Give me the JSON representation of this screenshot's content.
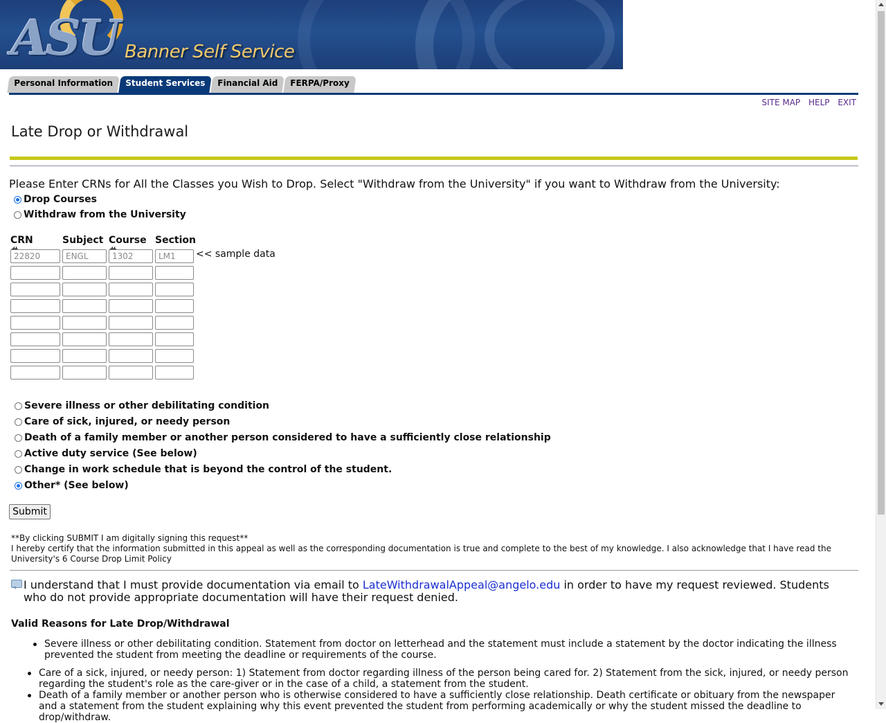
{
  "banner": {
    "logo_text": "ASU",
    "title": "Banner Self Service"
  },
  "tabs": [
    {
      "label": "Personal Information",
      "active": false
    },
    {
      "label": "Student Services",
      "active": true
    },
    {
      "label": "Financial Aid",
      "active": false
    },
    {
      "label": "FERPA/Proxy",
      "active": false
    }
  ],
  "toplinks": {
    "site_map": "SITE MAP",
    "help": "HELP",
    "exit": "EXIT"
  },
  "page": {
    "title": "Late Drop or Withdrawal"
  },
  "instructions": "Please Enter CRNs for All the Classes you Wish to Drop. Select \"Withdraw from the University\" if you want to Withdraw from the University:",
  "drop_options": [
    {
      "label": "Drop Courses",
      "checked": true
    },
    {
      "label": "Withdraw from the University",
      "checked": false
    }
  ],
  "table": {
    "headers": {
      "crn": "CRN #",
      "subject": "Subject",
      "course": "Course #",
      "section": "Section"
    },
    "sample": {
      "crn": "22820",
      "subject": "ENGL",
      "course": "1302",
      "section": "LM1"
    },
    "sample_note": "<< sample data",
    "empty_rows": 7
  },
  "reasons": [
    {
      "label": "Severe illness or other debilitating condition",
      "checked": false
    },
    {
      "label": "Care of sick, injured, or needy person",
      "checked": false
    },
    {
      "label": "Death of a family member or another person considered to have a sufficiently close relationship",
      "checked": false
    },
    {
      "label": "Active duty service (See below)",
      "checked": false
    },
    {
      "label": "Change in work schedule that is beyond the control of the student.",
      "checked": false
    },
    {
      "label": "Other* (See below)",
      "checked": true
    }
  ],
  "submit_label": "Submit",
  "certification": {
    "line1": "**By clicking SUBMIT I am digitally signing this request**",
    "line2": "I hereby certify that the information submitted in this appeal as well as the corresponding documentation is true and complete to the best of my knowledge. I also acknowledge that I have read the University's 6 Course Drop Limit Policy"
  },
  "documentation_note": {
    "before": "I understand that I must provide documentation via email to ",
    "email": "LateWithdrawalAppeal@angelo.edu",
    "after": " in order to have my request reviewed. Students who do not provide appropriate documentation will have their request denied."
  },
  "valid_reasons": {
    "title": "Valid Reasons for Late Drop/Withdrawal",
    "items": [
      "Severe illness or other debilitating condition. Statement from doctor on letterhead and the statement must include a statement by the doctor indicating the illness prevented the student from meeting the deadline or requirements of the course.",
      "Care of a sick, injured, or needy person: 1) Statement from doctor regarding illness of the person being cared for. 2) Statement from the sick, injured, or needy person regarding the student's role as the care-giver or in the case of a child, a statement from the student.",
      "Death of a family member or another person who is otherwise considered to have a sufficiently close relationship. Death certificate or obituary from the newspaper and a statement from the student explaining why this event prevented the student from performing academically or why the student missed the deadline to drop/withdraw."
    ]
  }
}
